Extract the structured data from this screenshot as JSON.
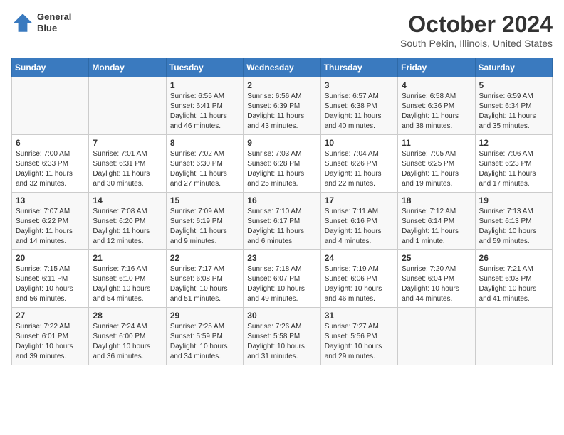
{
  "logo": {
    "line1": "General",
    "line2": "Blue"
  },
  "title": "October 2024",
  "subtitle": "South Pekin, Illinois, United States",
  "weekdays": [
    "Sunday",
    "Monday",
    "Tuesday",
    "Wednesday",
    "Thursday",
    "Friday",
    "Saturday"
  ],
  "weeks": [
    [
      {
        "day": "",
        "info": ""
      },
      {
        "day": "",
        "info": ""
      },
      {
        "day": "1",
        "info": "Sunrise: 6:55 AM\nSunset: 6:41 PM\nDaylight: 11 hours and 46 minutes."
      },
      {
        "day": "2",
        "info": "Sunrise: 6:56 AM\nSunset: 6:39 PM\nDaylight: 11 hours and 43 minutes."
      },
      {
        "day": "3",
        "info": "Sunrise: 6:57 AM\nSunset: 6:38 PM\nDaylight: 11 hours and 40 minutes."
      },
      {
        "day": "4",
        "info": "Sunrise: 6:58 AM\nSunset: 6:36 PM\nDaylight: 11 hours and 38 minutes."
      },
      {
        "day": "5",
        "info": "Sunrise: 6:59 AM\nSunset: 6:34 PM\nDaylight: 11 hours and 35 minutes."
      }
    ],
    [
      {
        "day": "6",
        "info": "Sunrise: 7:00 AM\nSunset: 6:33 PM\nDaylight: 11 hours and 32 minutes."
      },
      {
        "day": "7",
        "info": "Sunrise: 7:01 AM\nSunset: 6:31 PM\nDaylight: 11 hours and 30 minutes."
      },
      {
        "day": "8",
        "info": "Sunrise: 7:02 AM\nSunset: 6:30 PM\nDaylight: 11 hours and 27 minutes."
      },
      {
        "day": "9",
        "info": "Sunrise: 7:03 AM\nSunset: 6:28 PM\nDaylight: 11 hours and 25 minutes."
      },
      {
        "day": "10",
        "info": "Sunrise: 7:04 AM\nSunset: 6:26 PM\nDaylight: 11 hours and 22 minutes."
      },
      {
        "day": "11",
        "info": "Sunrise: 7:05 AM\nSunset: 6:25 PM\nDaylight: 11 hours and 19 minutes."
      },
      {
        "day": "12",
        "info": "Sunrise: 7:06 AM\nSunset: 6:23 PM\nDaylight: 11 hours and 17 minutes."
      }
    ],
    [
      {
        "day": "13",
        "info": "Sunrise: 7:07 AM\nSunset: 6:22 PM\nDaylight: 11 hours and 14 minutes."
      },
      {
        "day": "14",
        "info": "Sunrise: 7:08 AM\nSunset: 6:20 PM\nDaylight: 11 hours and 12 minutes."
      },
      {
        "day": "15",
        "info": "Sunrise: 7:09 AM\nSunset: 6:19 PM\nDaylight: 11 hours and 9 minutes."
      },
      {
        "day": "16",
        "info": "Sunrise: 7:10 AM\nSunset: 6:17 PM\nDaylight: 11 hours and 6 minutes."
      },
      {
        "day": "17",
        "info": "Sunrise: 7:11 AM\nSunset: 6:16 PM\nDaylight: 11 hours and 4 minutes."
      },
      {
        "day": "18",
        "info": "Sunrise: 7:12 AM\nSunset: 6:14 PM\nDaylight: 11 hours and 1 minute."
      },
      {
        "day": "19",
        "info": "Sunrise: 7:13 AM\nSunset: 6:13 PM\nDaylight: 10 hours and 59 minutes."
      }
    ],
    [
      {
        "day": "20",
        "info": "Sunrise: 7:15 AM\nSunset: 6:11 PM\nDaylight: 10 hours and 56 minutes."
      },
      {
        "day": "21",
        "info": "Sunrise: 7:16 AM\nSunset: 6:10 PM\nDaylight: 10 hours and 54 minutes."
      },
      {
        "day": "22",
        "info": "Sunrise: 7:17 AM\nSunset: 6:08 PM\nDaylight: 10 hours and 51 minutes."
      },
      {
        "day": "23",
        "info": "Sunrise: 7:18 AM\nSunset: 6:07 PM\nDaylight: 10 hours and 49 minutes."
      },
      {
        "day": "24",
        "info": "Sunrise: 7:19 AM\nSunset: 6:06 PM\nDaylight: 10 hours and 46 minutes."
      },
      {
        "day": "25",
        "info": "Sunrise: 7:20 AM\nSunset: 6:04 PM\nDaylight: 10 hours and 44 minutes."
      },
      {
        "day": "26",
        "info": "Sunrise: 7:21 AM\nSunset: 6:03 PM\nDaylight: 10 hours and 41 minutes."
      }
    ],
    [
      {
        "day": "27",
        "info": "Sunrise: 7:22 AM\nSunset: 6:01 PM\nDaylight: 10 hours and 39 minutes."
      },
      {
        "day": "28",
        "info": "Sunrise: 7:24 AM\nSunset: 6:00 PM\nDaylight: 10 hours and 36 minutes."
      },
      {
        "day": "29",
        "info": "Sunrise: 7:25 AM\nSunset: 5:59 PM\nDaylight: 10 hours and 34 minutes."
      },
      {
        "day": "30",
        "info": "Sunrise: 7:26 AM\nSunset: 5:58 PM\nDaylight: 10 hours and 31 minutes."
      },
      {
        "day": "31",
        "info": "Sunrise: 7:27 AM\nSunset: 5:56 PM\nDaylight: 10 hours and 29 minutes."
      },
      {
        "day": "",
        "info": ""
      },
      {
        "day": "",
        "info": ""
      }
    ]
  ]
}
